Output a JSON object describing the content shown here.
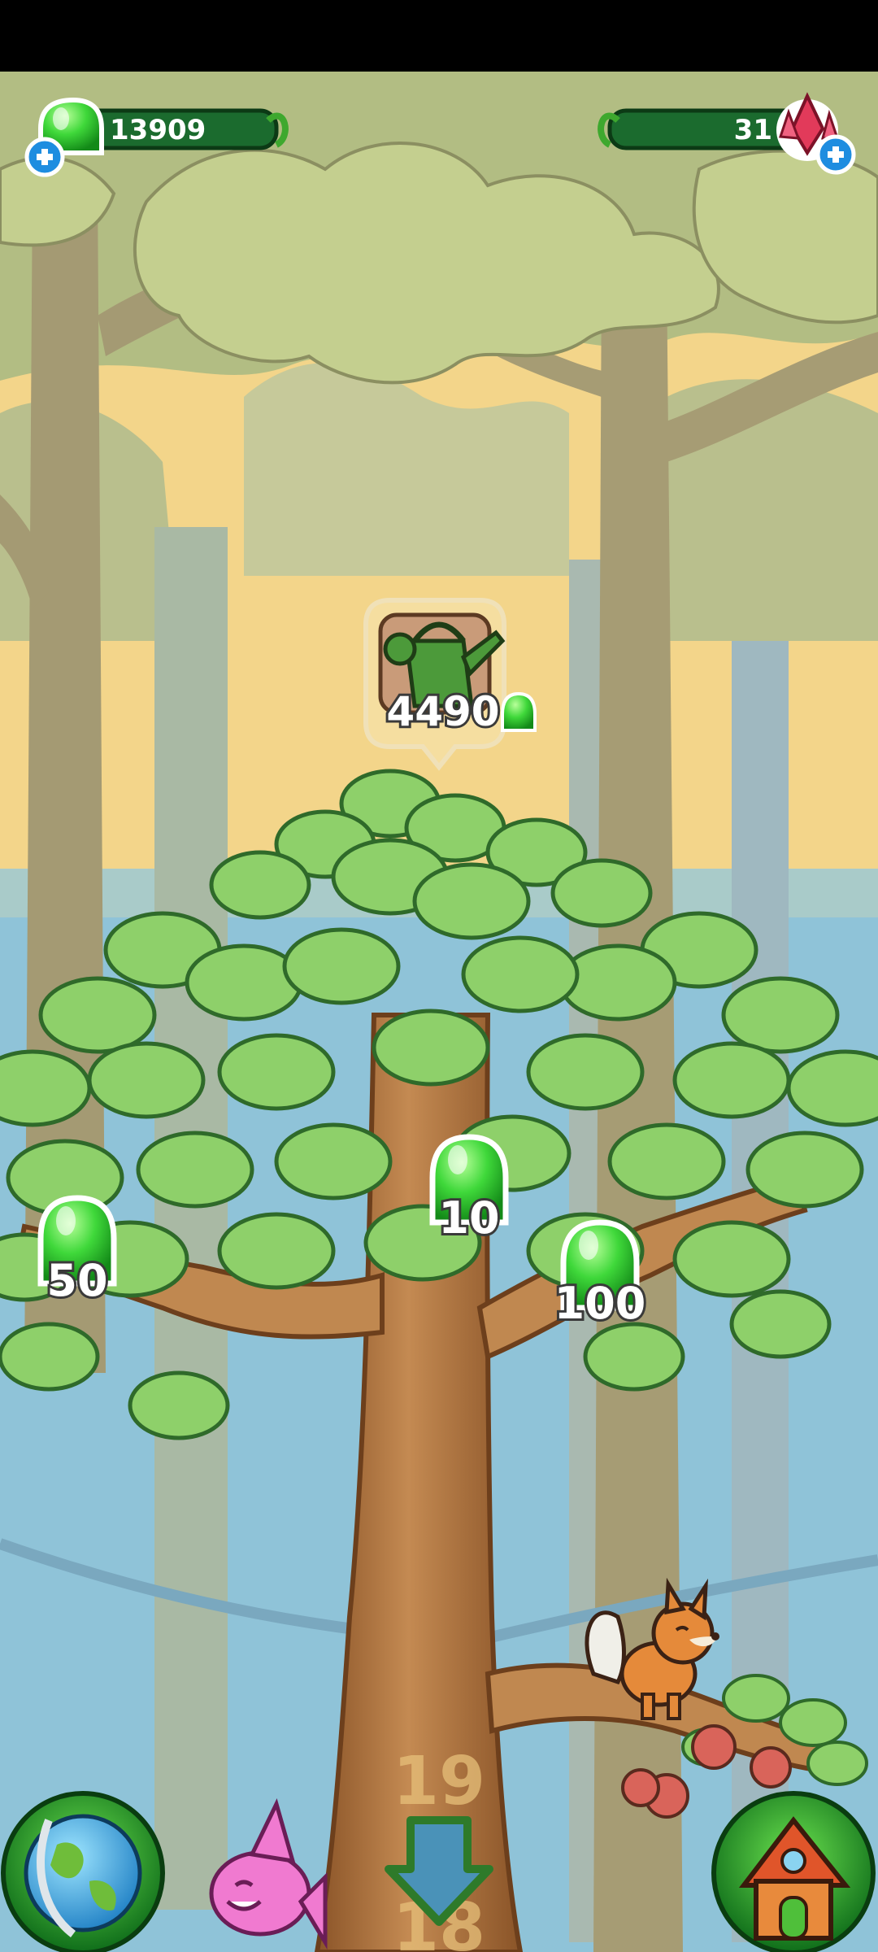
{
  "hud": {
    "gems": {
      "value": "13909",
      "icon": "green-gem-icon"
    },
    "crystals": {
      "value": "31",
      "icon": "red-crystal-icon"
    },
    "add_icon": "plus-icon"
  },
  "shop_bubble": {
    "item_icon": "watering-can-icon",
    "price": "4490",
    "currency_icon": "green-gem-icon"
  },
  "rewards": [
    {
      "value": "50",
      "icon": "green-gem-icon"
    },
    {
      "value": "10",
      "icon": "green-gem-icon"
    },
    {
      "value": "100",
      "icon": "green-gem-icon"
    }
  ],
  "tree": {
    "level": "19",
    "next_level": "18"
  },
  "bottom_bar": {
    "globe_icon": "globe-icon",
    "fish_icon": "pink-fish-icon",
    "down_icon": "down-arrow-icon",
    "house_icon": "house-icon"
  },
  "colors": {
    "background_sky": "#f3d58a",
    "gem": "#3fd83a",
    "hud_bar": "#1b6b2e",
    "crystal": "#e23a5a",
    "leaf": "#8ed06a",
    "trunk": "#b87a45"
  }
}
